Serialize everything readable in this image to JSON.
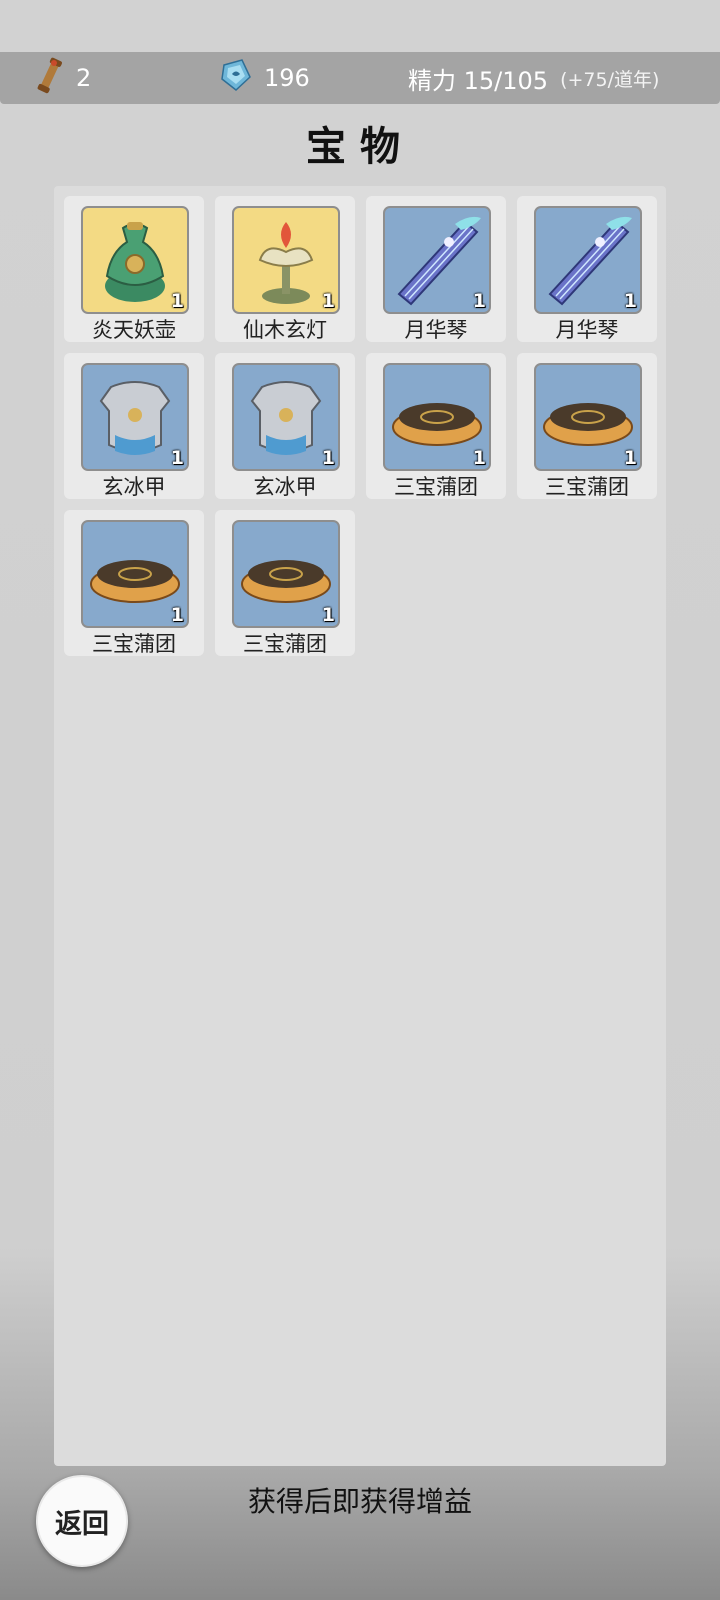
{
  "status_bar": {
    "scroll_count": "2",
    "crystal_count": "196",
    "stamina_label": "精力 15/105",
    "stamina_regen": "(+75/道年)"
  },
  "title": "宝物",
  "items": [
    {
      "name": "炎天妖壶",
      "qty": "1",
      "icon": "vase-icon",
      "bg": "#f3da84"
    },
    {
      "name": "仙木玄灯",
      "qty": "1",
      "icon": "lotus-lamp-icon",
      "bg": "#f3da84"
    },
    {
      "name": "月华琴",
      "qty": "1",
      "icon": "zither-icon",
      "bg": "#87a9cc"
    },
    {
      "name": "月华琴",
      "qty": "1",
      "icon": "zither-icon",
      "bg": "#87a9cc"
    },
    {
      "name": "玄冰甲",
      "qty": "1",
      "icon": "armor-icon",
      "bg": "#87a9cc"
    },
    {
      "name": "玄冰甲",
      "qty": "1",
      "icon": "armor-icon",
      "bg": "#87a9cc"
    },
    {
      "name": "三宝蒲团",
      "qty": "1",
      "icon": "cushion-icon",
      "bg": "#87a9cc"
    },
    {
      "name": "三宝蒲团",
      "qty": "1",
      "icon": "cushion-icon",
      "bg": "#87a9cc"
    },
    {
      "name": "三宝蒲团",
      "qty": "1",
      "icon": "cushion-icon",
      "bg": "#87a9cc"
    },
    {
      "name": "三宝蒲团",
      "qty": "1",
      "icon": "cushion-icon",
      "bg": "#87a9cc"
    }
  ],
  "footer": {
    "hint": "获得后即获得增益",
    "back_label": "返回"
  }
}
